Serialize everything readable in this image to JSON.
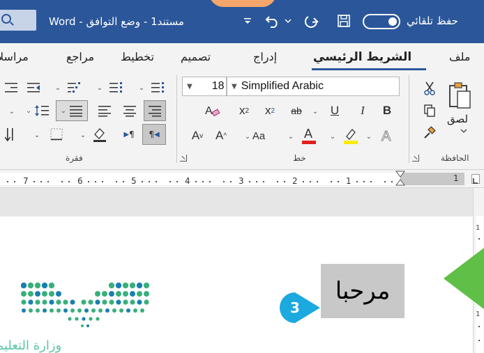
{
  "titlebar": {
    "autosave_label": "حفظ تلقائي",
    "doc_title": "مستند1 - وضع التوافق - Word"
  },
  "tabs": [
    "ملف",
    "الشريط الرئيسي",
    "إدراج",
    "تصميم",
    "تخطيط",
    "مراجع",
    "مراسلا"
  ],
  "active_tab": "الشريط الرئيسي",
  "clipboard": {
    "paste_label": "لصق",
    "group_label": "الحافظة"
  },
  "font": {
    "name": "Simplified Arabic",
    "size": "18",
    "group_label": "خط"
  },
  "paragraph": {
    "group_label": "فقرة"
  },
  "ruler": {
    "numbers": [
      "7",
      "6",
      "5",
      "4",
      "3",
      "2",
      "1",
      "1"
    ]
  },
  "vertical_ruler": {
    "numbers": [
      "1",
      "1"
    ]
  },
  "document": {
    "selected_text": "مرحبا"
  },
  "step_badge": "3",
  "watermark": "وزارة التعليم",
  "colors": {
    "title_bar": "#2b579a",
    "font_color_bar": "#e0201b",
    "highlight_bar": "#ffeb00",
    "badge": "#1ba9e0",
    "arrow": "#5fbf47",
    "logo_green": "#3aaf7b",
    "logo_blue": "#1a7fb0"
  }
}
